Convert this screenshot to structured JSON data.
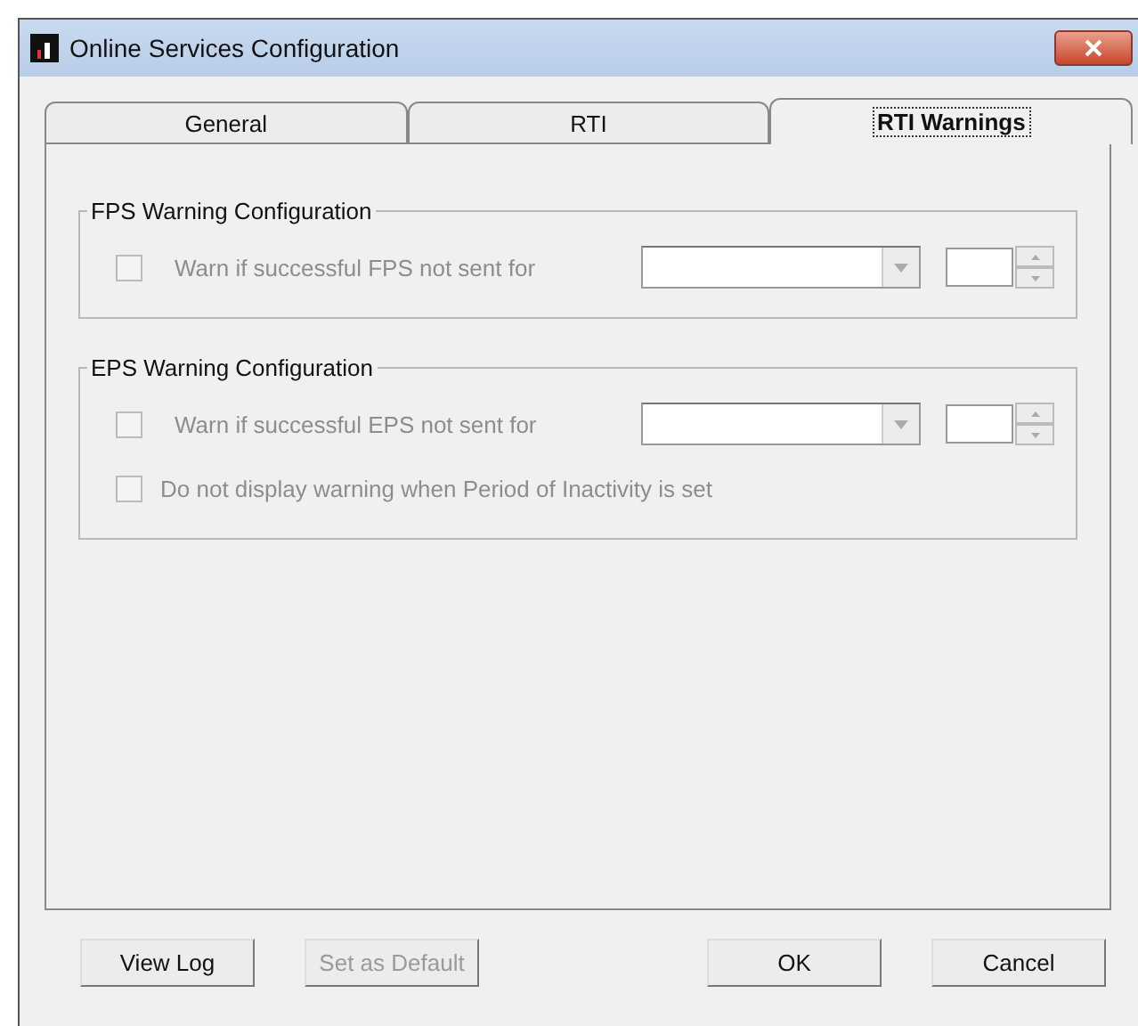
{
  "window": {
    "title": "Online Services Configuration"
  },
  "tabs": [
    {
      "label": "General",
      "selected": false
    },
    {
      "label": "RTI",
      "selected": false
    },
    {
      "label": "RTI Warnings",
      "selected": true
    }
  ],
  "groups": [
    {
      "title": "FPS Warning Configuration",
      "rows": [
        {
          "kind": "period",
          "label": "Warn if successful FPS not sent for",
          "checked": false,
          "disabled": true
        }
      ]
    },
    {
      "title": "EPS Warning Configuration",
      "rows": [
        {
          "kind": "period",
          "label": "Warn if successful EPS not sent for",
          "checked": false,
          "disabled": true
        },
        {
          "kind": "check",
          "label": "Do not display warning when Period of Inactivity is set",
          "checked": false,
          "disabled": true
        }
      ]
    }
  ],
  "buttons": [
    {
      "label": "View Log",
      "disabled": false
    },
    {
      "label": "Set as Default",
      "disabled": true
    },
    {
      "label": "OK",
      "disabled": false
    },
    {
      "label": "Cancel",
      "disabled": false
    }
  ]
}
